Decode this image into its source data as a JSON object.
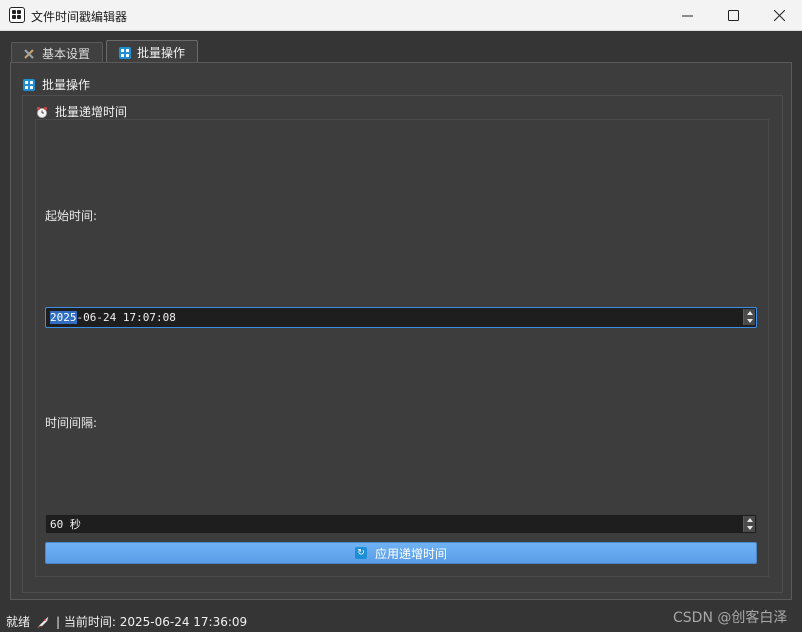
{
  "window": {
    "title": "文件时间戳编辑器",
    "min_glyph": "—",
    "max_glyph": "☐",
    "close_glyph": "✕"
  },
  "tabs": [
    {
      "label": "基本设置",
      "icon": "tools-icon",
      "active": false
    },
    {
      "label": "批量操作",
      "icon": "grid-icon",
      "active": true
    }
  ],
  "batch": {
    "group_title": "批量操作",
    "section_title": "批量递增时间",
    "start_label": "起始时间:",
    "start_value_selected": "2025",
    "start_value_rest": "-06-24 17:07:08",
    "interval_label": "时间间隔:",
    "interval_value": "60 秒",
    "apply_label": "应用递增时间"
  },
  "status": {
    "ready": "就绪",
    "current_time": "| 当前时间: 2025-06-24 17:36:09"
  },
  "watermark": "CSDN @创客白泽",
  "colors": {
    "accent": "#3d8ee6",
    "button": "#6fb2f4",
    "background": "#353535"
  }
}
